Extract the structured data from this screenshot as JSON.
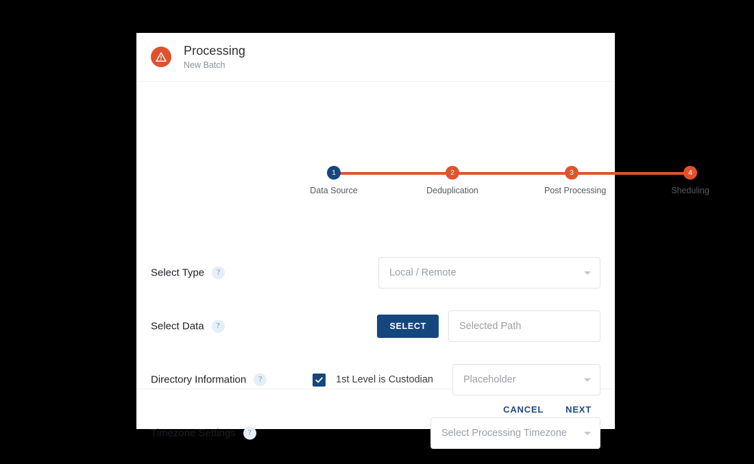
{
  "header": {
    "icon": "warning-triangle-icon",
    "title": "Processing",
    "subtitle": "New Batch",
    "accent_color": "#e0522d"
  },
  "stepper": {
    "active_color": "#14477d",
    "pending_color": "#e0522d",
    "steps": [
      {
        "number": "1",
        "label": "Data Source",
        "state": "active"
      },
      {
        "number": "2",
        "label": "Deduplication",
        "state": "pending"
      },
      {
        "number": "3",
        "label": "Post Processing",
        "state": "pending"
      },
      {
        "number": "4",
        "label": "Sheduling",
        "state": "pending"
      }
    ]
  },
  "form": {
    "help_glyph": "?",
    "rows": [
      {
        "label": "Select Type",
        "select_placeholder": "Local / Remote"
      },
      {
        "label": "Select Data",
        "button_label": "SELECT",
        "input_placeholder": "Selected Path"
      },
      {
        "label": "Directory Information",
        "checkbox_label": "1st Level is Custodian",
        "checkbox_checked": true,
        "select_placeholder": "Placeholder"
      },
      {
        "label": "Timezone Settings",
        "select_placeholder": "Select Processing Timezone"
      }
    ]
  },
  "footer": {
    "cancel_label": "CANCEL",
    "next_label": "NEXT",
    "link_color": "#1c4a7e"
  }
}
